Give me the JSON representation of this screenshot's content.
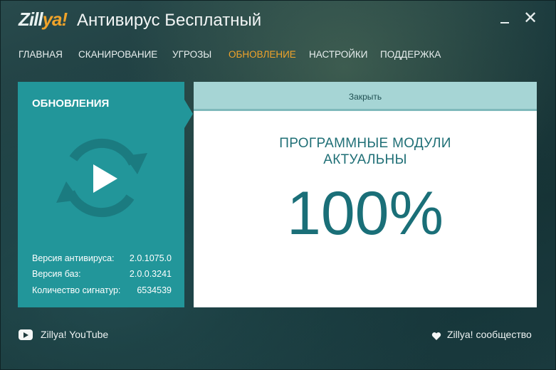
{
  "window": {
    "logo_main": "Zill",
    "logo_accent": "ya!",
    "title": "Антивирус Бесплатный",
    "minimize_icon": "minimize-icon",
    "close_icon": "close-icon",
    "close_glyph": "✕"
  },
  "nav": {
    "items": [
      {
        "label": "ГЛАВНАЯ"
      },
      {
        "label": "СКАНИРОВАНИЕ"
      },
      {
        "label": "УГРОЗЫ"
      },
      {
        "label": "ОБНОВЛЕНИЕ",
        "active": true
      },
      {
        "label": "НАСТРОЙКИ"
      },
      {
        "label": "ПОДДЕРЖКА"
      }
    ]
  },
  "update_panel": {
    "title": "ОБНОВЛЕНИЯ",
    "icon": "update-play-icon",
    "info": [
      {
        "label": "Версия антивируса:",
        "value": "2.0.1075.0"
      },
      {
        "label": "Версия баз:",
        "value": "2.0.0.3241"
      },
      {
        "label": "Количество сигнатур:",
        "value": "6534539"
      }
    ]
  },
  "status_panel": {
    "close_label": "Закрыть",
    "status_line1": "ПРОГРАММНЫЕ МОДУЛИ",
    "status_line2": "АКТУАЛЬНЫ",
    "percent": "100%"
  },
  "footer": {
    "youtube_label": "Zillya! YouTube",
    "community_label": "Zillya! сообщество"
  },
  "colors": {
    "accent": "#f0a32a",
    "panel_teal": "#22969a",
    "close_bar": "#a6d5d5",
    "percent_text": "#1a6f78"
  }
}
